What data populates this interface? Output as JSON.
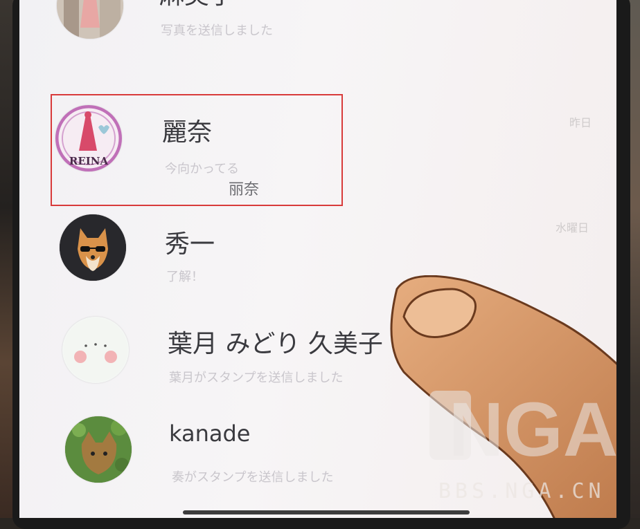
{
  "chats": [
    {
      "name": "麻美子",
      "preview": "写真を送信しました",
      "time": "",
      "avatar": "mamiko-avatar"
    },
    {
      "name": "麗奈",
      "preview": "今向かってる",
      "time": "昨日",
      "avatar": "reina-avatar",
      "avatar_text": "REINA"
    },
    {
      "name": "秀一",
      "preview": "了解！",
      "time": "水曜日",
      "avatar": "shiba-dog-avatar"
    },
    {
      "name": "葉月 みどり 久美子",
      "preview": "葉月がスタンプを送信しました",
      "time": "",
      "avatar": "blush-face-avatar"
    },
    {
      "name": "kanade",
      "preview": "奏がスタンプを送信しました",
      "time": "",
      "avatar": "dog-avatar"
    }
  ],
  "annotation": {
    "text": "丽奈",
    "color": "#d83a3a"
  },
  "watermark": {
    "logo": "NGA",
    "text": "BBS.NGA.CN"
  }
}
